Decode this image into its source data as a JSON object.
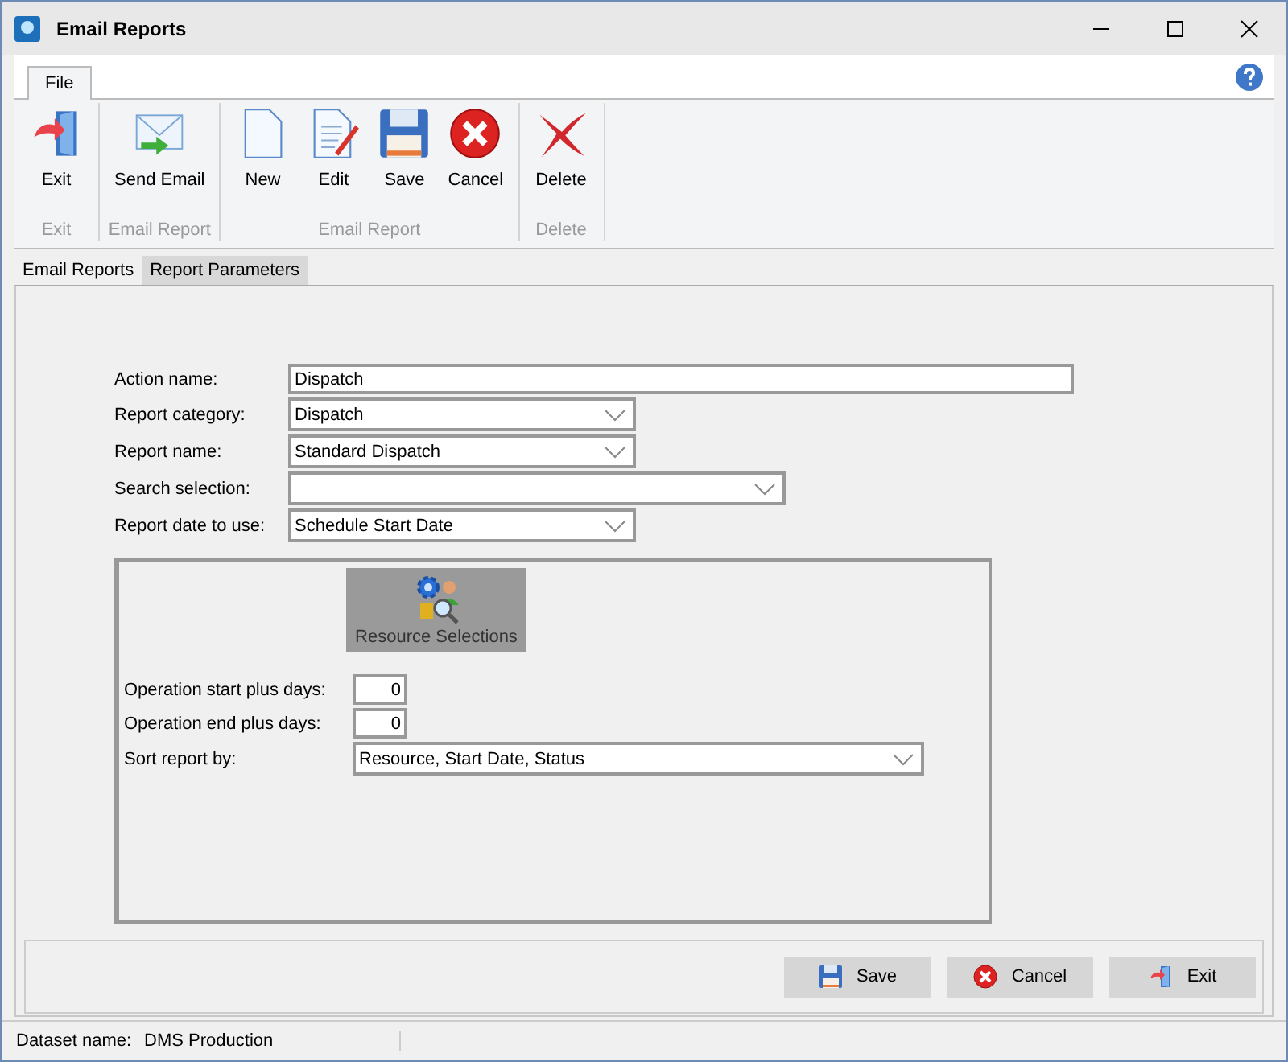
{
  "window": {
    "title": "Email Reports"
  },
  "ribbon": {
    "tabs": [
      {
        "label": "File",
        "selected": true
      }
    ],
    "groups": [
      {
        "label": "Exit",
        "buttons": [
          {
            "label": "Exit",
            "kind": "exit"
          }
        ]
      },
      {
        "label": "Email Report",
        "buttons": [
          {
            "label": "Send Email",
            "kind": "email"
          }
        ]
      },
      {
        "label": "Email Report",
        "buttons": [
          {
            "label": "New",
            "kind": "new"
          },
          {
            "label": "Edit",
            "kind": "edit"
          },
          {
            "label": "Save",
            "kind": "save"
          },
          {
            "label": "Cancel",
            "kind": "cancel"
          }
        ]
      },
      {
        "label": "Delete",
        "buttons": [
          {
            "label": "Delete",
            "kind": "delete"
          }
        ]
      }
    ]
  },
  "tabs": [
    {
      "label": "Email Reports",
      "selected": false
    },
    {
      "label": "Report Parameters",
      "selected": true
    }
  ],
  "form": {
    "fields": [
      {
        "label": "Action name:",
        "kind": "text",
        "value": "Dispatch"
      },
      {
        "label": "Report category:",
        "kind": "dropdown",
        "value": "Dispatch"
      },
      {
        "label": "Report name:",
        "kind": "dropdown",
        "value": "Standard Dispatch"
      },
      {
        "label": "Search selection:",
        "kind": "dropdown"
      },
      {
        "label": "Report date to use:",
        "kind": "dropdown",
        "value": "Schedule Start Date"
      }
    ]
  },
  "panel": {
    "resource_button": "Resource Selections",
    "fields": [
      {
        "label": "Operation start plus days:",
        "kind": "number",
        "value": "0"
      },
      {
        "label": "Operation end plus days:",
        "kind": "number",
        "value": "0"
      },
      {
        "label": "Sort report by:",
        "kind": "dropdown",
        "value": "Resource, Start Date, Status"
      }
    ]
  },
  "buttons": [
    {
      "label": "Save",
      "kind": "save"
    },
    {
      "label": "Cancel",
      "kind": "cancel"
    },
    {
      "label": "Exit",
      "kind": "exit"
    }
  ],
  "status_bar": {
    "label": "Dataset name:",
    "value": "DMS Production"
  }
}
